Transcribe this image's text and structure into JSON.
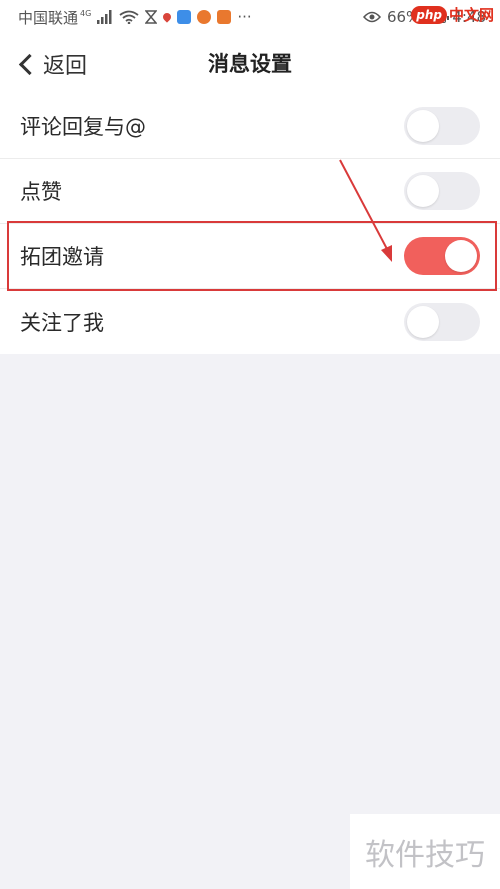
{
  "status_bar": {
    "carrier": "中国联通",
    "network": "4G",
    "battery": "66%",
    "time": "4:48"
  },
  "nav": {
    "back_label": "返回",
    "title": "消息设置"
  },
  "settings": [
    {
      "label": "评论回复与@",
      "enabled": false
    },
    {
      "label": "点赞",
      "enabled": false
    },
    {
      "label": "拓团邀请",
      "enabled": true
    },
    {
      "label": "关注了我",
      "enabled": false
    }
  ],
  "colors": {
    "toggle_on": "#f1605c",
    "toggle_off": "#ececf0",
    "annotation": "#d93a3a",
    "background": "#f2f2f6"
  },
  "watermarks": {
    "php_badge": "php",
    "php_text": "中文网",
    "bottom": "软件技巧"
  }
}
